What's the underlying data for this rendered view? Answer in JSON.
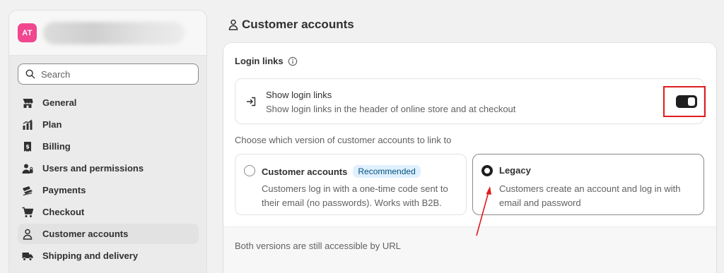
{
  "sidebar": {
    "store_initials": "AT",
    "search": {
      "placeholder": "Search"
    },
    "items": [
      {
        "label": "General",
        "icon": "store-icon"
      },
      {
        "label": "Plan",
        "icon": "plan-icon"
      },
      {
        "label": "Billing",
        "icon": "billing-icon"
      },
      {
        "label": "Users and permissions",
        "icon": "users-icon"
      },
      {
        "label": "Payments",
        "icon": "payments-icon"
      },
      {
        "label": "Checkout",
        "icon": "cart-icon"
      },
      {
        "label": "Customer accounts",
        "icon": "person-icon",
        "active": true
      },
      {
        "label": "Shipping and delivery",
        "icon": "truck-icon"
      }
    ]
  },
  "page": {
    "title": "Customer accounts",
    "title_icon": "person-icon"
  },
  "login_links": {
    "heading": "Login links",
    "show_title": "Show login links",
    "show_description": "Show login links in the header of online store and at checkout",
    "toggle_on": true
  },
  "versions": {
    "prompt": "Choose which version of customer accounts to link to",
    "options": [
      {
        "title": "Customer accounts",
        "badge": "Recommended",
        "description": "Customers log in with a one-time code sent to their email (no passwords). Works with B2B.",
        "selected": false
      },
      {
        "title": "Legacy",
        "description": "Customers create an account and log in with email and password",
        "selected": true
      }
    ],
    "footer": "Both versions are still accessible by URL"
  },
  "colors": {
    "avatar": "#f0478f",
    "highlight": "#e01c1c",
    "badge_bg": "#e0f0ff",
    "badge_text": "#00527c"
  }
}
